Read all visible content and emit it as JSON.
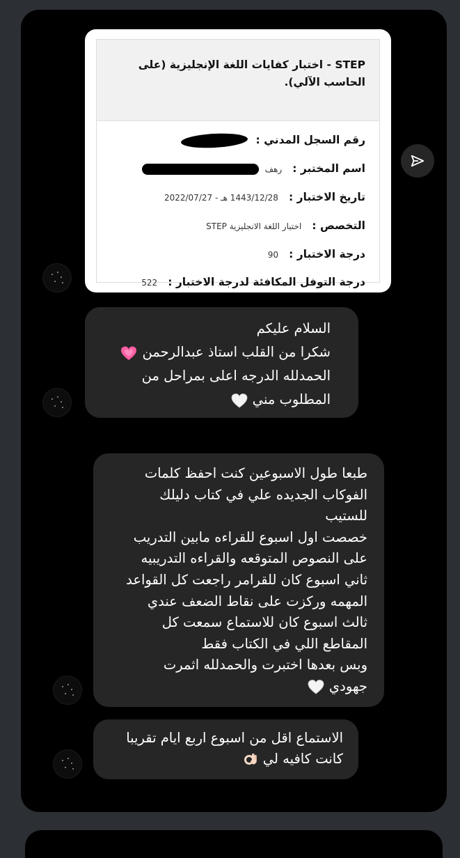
{
  "shared_card": {
    "title": "STEP - اختبار كفايات اللغة الإنجليزية (على الحاسب الآلي).",
    "rows": [
      {
        "label": "رقم السجل المدني :",
        "value": ""
      },
      {
        "label": "اسم المختبر :",
        "value": "رهف"
      },
      {
        "label": "تاريخ الاختبار :",
        "value": "1443/12/28 هـ - 2022/07/27"
      },
      {
        "label": "التخصص :",
        "value": "اختبار اللغة الانجليزية STEP"
      },
      {
        "label": "درجة الاختبار :",
        "value": "90"
      },
      {
        "label": "درجة التوفل المكافئة لدرجة الاختبار :",
        "value": "522"
      }
    ]
  },
  "messages": [
    {
      "lines": [
        "السلام عليكم",
        "شكرا من القلب استاذ عبدالرحمن",
        "الحمدلله الدرجه اعلى بمراحل من",
        "المطلوب مني"
      ]
    },
    {
      "lines": [
        "طبعا طول الاسبوعين كنت احفظ كلمات",
        "الفوكاب الجديده علي في كتاب دليلك",
        "للستيب",
        "خصصت اول اسبوع للقراءه مابين التدريب",
        "على النصوص المتوقعه والقراءه التدريبيه",
        "ثاني اسبوع كان للقرامر راجعت كل القواعد",
        "المهمه وركزت على نقاط الضعف عندي",
        "ثالث اسبوع كان للاستماع سمعت كل",
        "المقاطع اللي في الكتاب فقط",
        "وبس بعدها اختبرت والحمدلله اثمرت",
        "جهودي"
      ]
    },
    {
      "lines": [
        "الاستماع اقل من اسبوع اربع ايام تقريبا",
        "كانت كافيه لي"
      ]
    }
  ],
  "colors": {
    "background": "#2c2f33",
    "chat_background": "#000000",
    "bubble": "#262626",
    "text": "#ffffff"
  },
  "icons": [
    "send-icon",
    "growing-heart-emoji",
    "white-heart-emoji",
    "ok-hand-emoji",
    "avatar"
  ]
}
